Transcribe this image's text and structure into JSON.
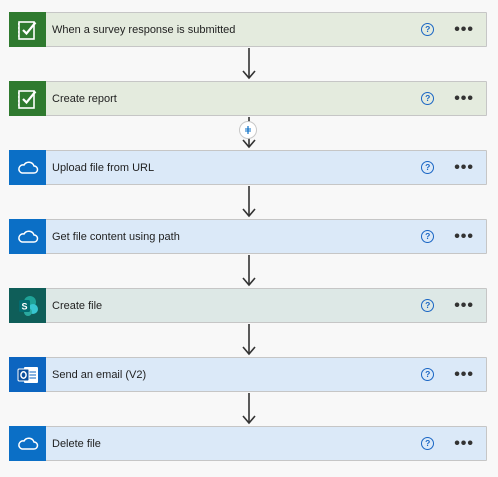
{
  "steps": [
    {
      "label": "When a survey response is submitted",
      "theme": "green",
      "icon": "forms-icon",
      "help": "?",
      "more": "•••"
    },
    {
      "label": "Create report",
      "theme": "green",
      "icon": "forms-icon",
      "help": "?",
      "more": "•••"
    },
    {
      "label": "Upload file from URL",
      "theme": "blue",
      "icon": "onedrive-cloud-icon",
      "help": "?",
      "more": "•••"
    },
    {
      "label": "Get file content using path",
      "theme": "blue",
      "icon": "onedrive-cloud-icon",
      "help": "?",
      "more": "•••"
    },
    {
      "label": "Create file",
      "theme": "teal",
      "icon": "sharepoint-icon",
      "help": "?",
      "more": "•••"
    },
    {
      "label": "Send an email (V2)",
      "theme": "blue",
      "icon": "outlook-icon",
      "help": "?",
      "more": "•••"
    },
    {
      "label": "Delete file",
      "theme": "blue",
      "icon": "onedrive-cloud-icon",
      "help": "?",
      "more": "•••"
    }
  ],
  "colors": {
    "forms": "#2f7a2f",
    "onedrive": "#0b6fc6",
    "sharepoint": "#0f5e59",
    "outlook": "#0c65c0",
    "help": "#1a66c4"
  }
}
